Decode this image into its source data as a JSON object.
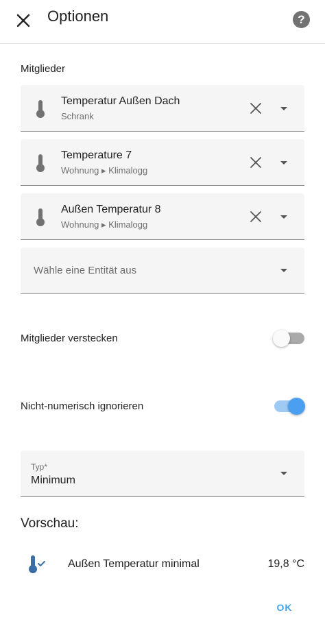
{
  "header": {
    "title": "Optionen",
    "help_label": "?"
  },
  "members": {
    "label": "Mitglieder",
    "items": [
      {
        "name": "Temperatur Außen Dach",
        "area": "Schrank"
      },
      {
        "name": "Temperature 7",
        "area": "Wohnung ▸ Klimalogg"
      },
      {
        "name": "Außen Temperatur 8",
        "area": "Wohnung ▸ Klimalogg"
      }
    ],
    "picker_placeholder": "Wähle eine Entität aus"
  },
  "toggles": {
    "hide_members": {
      "label": "Mitglieder verstecken",
      "on": false
    },
    "ignore_non_numeric": {
      "label": "Nicht-numerisch ignorieren",
      "on": true
    }
  },
  "type_select": {
    "label": "Typ*",
    "value": "Minimum"
  },
  "preview": {
    "heading": "Vorschau:",
    "name": "Außen Temperatur minimal",
    "value": "19,8 °C"
  },
  "actions": {
    "ok_label": "OK"
  },
  "colors": {
    "accent": "#43a1ea",
    "icon_gray": "#727272",
    "preview_icon": "#3b6ea5"
  }
}
